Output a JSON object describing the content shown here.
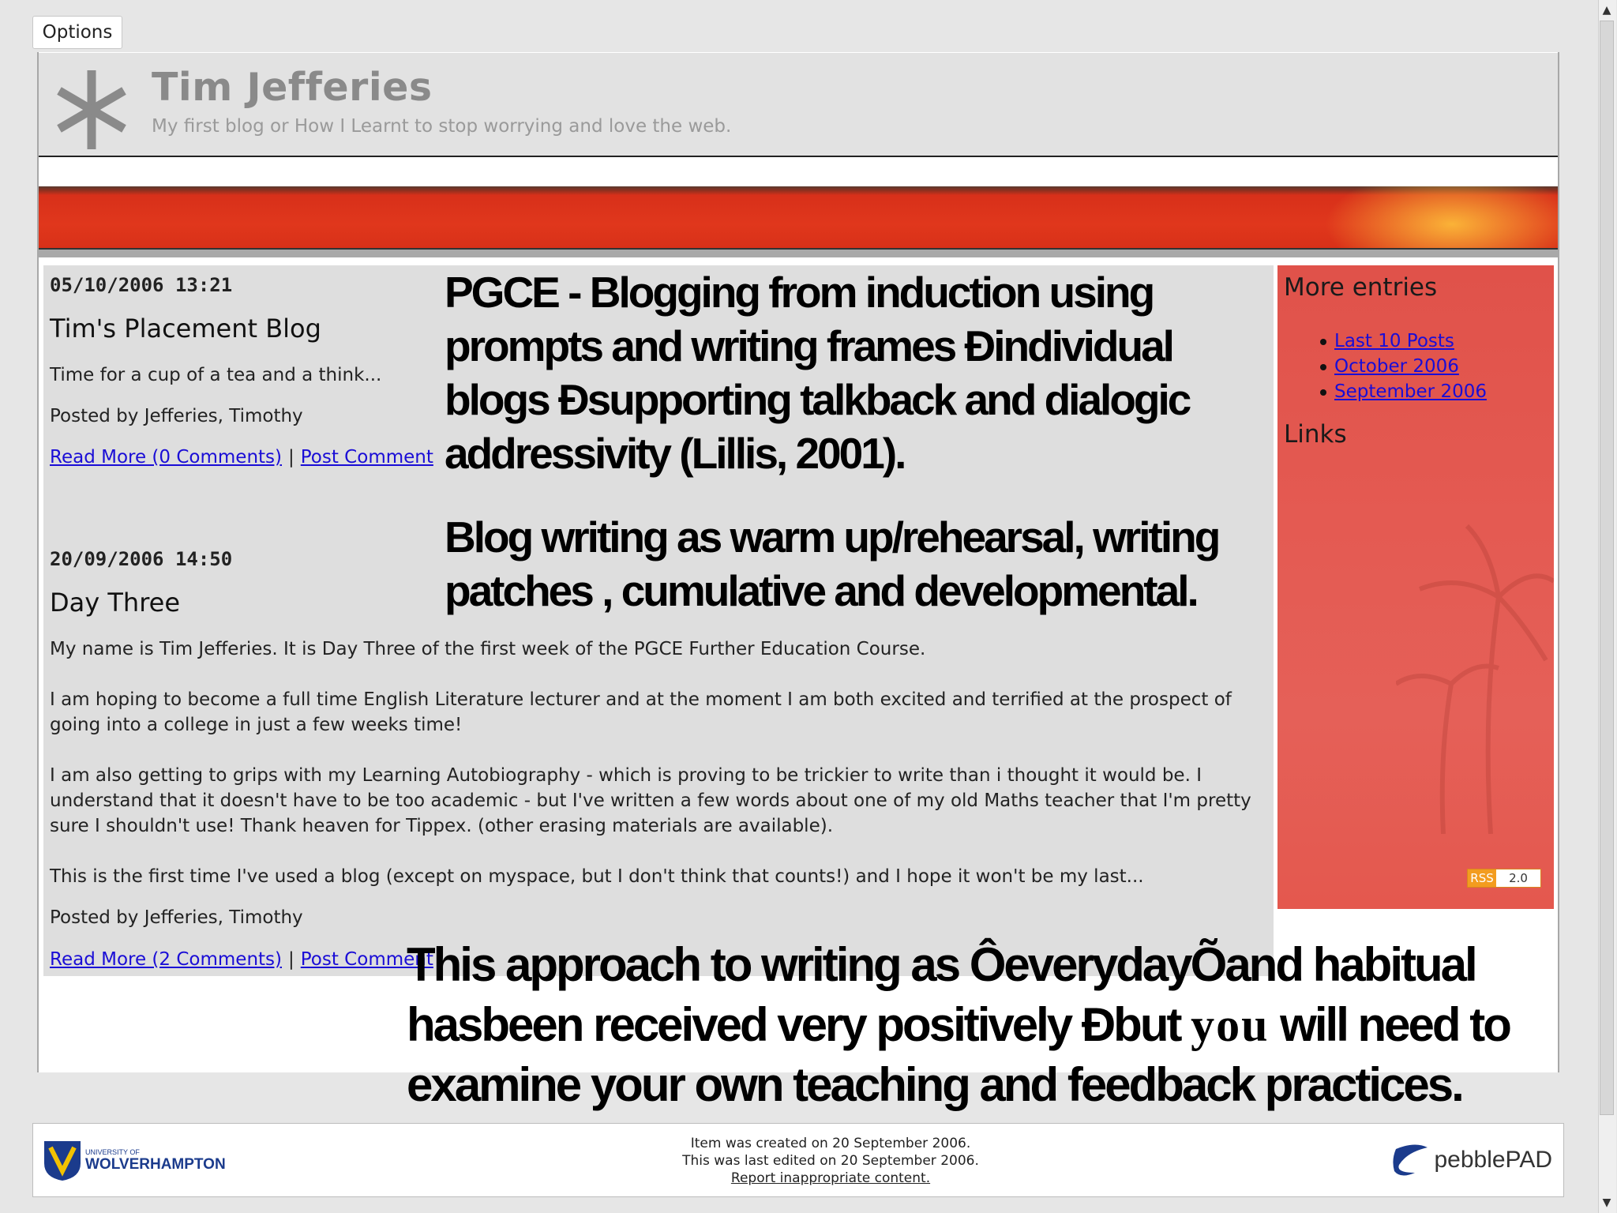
{
  "options_label": "Options",
  "blog": {
    "title": "Tim Jefferies",
    "subtitle": "My first blog or How I Learnt to stop worrying and love the web."
  },
  "posts": [
    {
      "date": "05/10/2006 13:21",
      "title": "Tim's Placement Blog",
      "body": "Time for a cup of a tea and a think...",
      "posted_by": "Posted by Jefferies, Timothy",
      "read_more": "Read More (0 Comments)",
      "separator": "|",
      "post_comment": "Post Comment"
    },
    {
      "date": "20/09/2006 14:50",
      "title": "Day Three",
      "paragraphs": [
        "My name is Tim Jefferies. It is Day Three of the first week of the PGCE Further Education Course.",
        "I am hoping to become a full time English Literature lecturer and at the moment I am both excited and terrified at the prospect of going into a college in just a few weeks time!",
        "I am also getting to grips with my Learning Autobiography - which is proving to be trickier to write than i thought it would be. I understand that it doesn't have to be too academic - but I've written a few words about one of my old Maths teacher that I'm pretty sure I shouldn't use! Thank heaven for Tippex. (other erasing materials are available).",
        "This is the first time I've used a blog (except on myspace, but I don't think that counts!) and I hope it won't be my last..."
      ],
      "posted_by": "Posted by Jefferies, Timothy",
      "read_more": "Read More (2 Comments)",
      "separator": "|",
      "post_comment": "Post Comment"
    }
  ],
  "sidebar": {
    "more_entries_heading": "More entries",
    "entries": [
      "Last 10 Posts",
      "October 2006",
      "September 2006"
    ],
    "links_heading": "Links",
    "rss_left": "RSS",
    "rss_right": "2.0"
  },
  "overlay": {
    "block1": "PGCE - Blogging from induction using prompts and writing frames Ðindividual blogs Ðsupporting talkback  and dialogic addressivity (Lillis, 2001).",
    "block2": "Blog writing as warm up/rehearsal, writing patches , cumulative and developmental.",
    "block3_a": "This approach to writing as ÔeverydayÕand habitual hasbeen received  very positively Ðbut ",
    "block3_you": "you",
    "block3_b": " will need to examine your own teaching and feedback practices."
  },
  "footer": {
    "university_small": "UNIVERSITY OF",
    "university_big": "WOLVERHAMPTON",
    "line1": "Item was created on 20 September 2006.",
    "line2": "This was last edited on 20 September 2006.",
    "report_link": "Report inappropriate content.",
    "pebble_label": "pebblePAD"
  }
}
